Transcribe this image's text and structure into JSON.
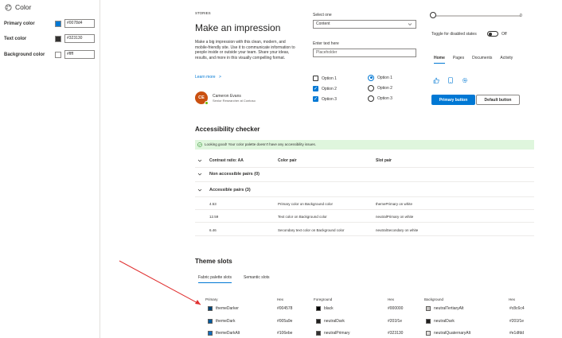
{
  "sidebar": {
    "title": "Color",
    "rows": [
      {
        "label": "Primary color",
        "hex": "#0078d4",
        "swatch": "#0078d4"
      },
      {
        "label": "Text color",
        "hex": "#323130",
        "swatch": "#323130"
      },
      {
        "label": "Background color",
        "hex": "#ffff",
        "swatch": "#ffffff"
      }
    ]
  },
  "hero": {
    "eyebrow": "STORIES",
    "title": "Make an impression",
    "body": "Make a big impression with this clean, modern, and mobile-friendly site. Use it to communicate information to people inside or outside your team. Share your ideas, results, and more in this visually compelling format.",
    "learn_more": "Learn more",
    "learn_more_chevron": ">",
    "persona": {
      "initials": "CE",
      "name": "Cameron Evans",
      "title": "Senior Researcher at Contoso"
    }
  },
  "form": {
    "select_label": "Select one",
    "select_value": "Content",
    "text_label": "Enter text here",
    "text_placeholder": "Placeholder",
    "checkboxes": [
      {
        "label": "Option 1",
        "checked": false
      },
      {
        "label": "Option 2",
        "checked": true
      },
      {
        "label": "Option 3",
        "checked": true
      }
    ],
    "radios": [
      {
        "label": "Option 1",
        "selected": true
      },
      {
        "label": "Option 2",
        "selected": false
      },
      {
        "label": "Option 3",
        "selected": false
      }
    ]
  },
  "controls": {
    "slider_value": "0",
    "slider_level": 0,
    "toggle_label": "Toggle for disabled states",
    "toggle_state": "Off",
    "tabs": [
      "Home",
      "Pages",
      "Documents",
      "Activity"
    ],
    "primary_button": "Primary button",
    "default_button": "Default button",
    "icons": [
      "like-icon",
      "phone-icon",
      "settings-icon"
    ]
  },
  "accessibility": {
    "title": "Accessibility checker",
    "banner": "Looking good! Your color palette doesn't have any accessibility issues.",
    "headers": {
      "contrast": "Contrast ratio: AA",
      "pair": "Color pair",
      "slot": "Slot pair"
    },
    "non_accessible": "Non accessible pairs (0)",
    "accessible": "Accessible pairs (3)",
    "pairs": [
      {
        "ratio": "4.53",
        "pair": "Primary color on Background color",
        "slot": "themePrimary on white"
      },
      {
        "ratio": "12.59",
        "pair": "Text color on Background color",
        "slot": "neutralPrimary on white"
      },
      {
        "ratio": "6.46",
        "pair": "Secondary text color on Background color",
        "slot": "neutralSecondary on white"
      }
    ]
  },
  "theme_slots": {
    "title": "Theme slots",
    "tabs": [
      "Fabric palette slots",
      "Semantic slots"
    ],
    "headers": [
      "Primary",
      "Hex",
      "Foreground",
      "Hex",
      "Background",
      "Hex"
    ],
    "rows": [
      {
        "p": "themeDarker",
        "ph": "#004578",
        "pc": "#004578",
        "f": "black",
        "fh": "#000000",
        "fc": "#000000",
        "b": "neutralTertiaryAlt",
        "bh": "#c8c6c4",
        "bc": "#c8c6c4"
      },
      {
        "p": "themeDark",
        "ph": "#005a9e",
        "pc": "#005a9e",
        "f": "neutralDark",
        "fh": "#201f1e",
        "fc": "#201f1e",
        "b": "neutralDark",
        "bh": "#201f1e",
        "bc": "#201f1e"
      },
      {
        "p": "themeDarkAlt",
        "ph": "#106ebe",
        "pc": "#106ebe",
        "f": "neutralPrimary",
        "fh": "#323130",
        "fc": "#323130",
        "b": "neutralQuaternaryAlt",
        "bh": "#e1dfdd",
        "bc": "#e1dfdd"
      }
    ]
  },
  "colors": {
    "accent": "#0078d4",
    "annotation_arrow": "#e03030"
  }
}
